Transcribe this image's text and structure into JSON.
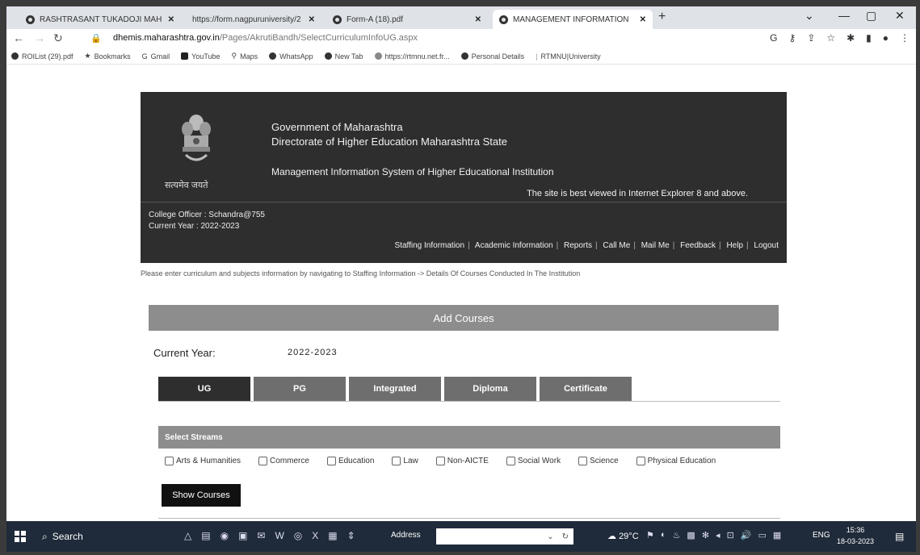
{
  "browser": {
    "tabs": [
      {
        "title": "RASHTRASANT TUKADOJI MAH",
        "active": false
      },
      {
        "title": "https://form.nagpuruniversity/2",
        "active": false
      },
      {
        "title": "Form-A (18).pdf",
        "active": false
      },
      {
        "title": "MANAGEMENT INFORMATION",
        "active": true
      }
    ],
    "new_tab": "+",
    "url_domain": "dhemis.maharashtra.gov.in",
    "url_path": "/Pages/AkrutiBandh/SelectCurriculumInfoUG.aspx",
    "bookmarks": [
      {
        "label": "ROIList (29).pdf",
        "color": "#333333"
      },
      {
        "label": "Bookmarks",
        "color": "#333333"
      },
      {
        "label": "Gmail",
        "color": "#777777"
      },
      {
        "label": "YouTube",
        "color": "#222222"
      },
      {
        "label": "Maps",
        "color": "#444444"
      },
      {
        "label": "WhatsApp",
        "color": "#333333"
      },
      {
        "label": "New Tab",
        "color": "#333333"
      },
      {
        "label": "https://rtmnu.net.fr...",
        "color": "#888888"
      },
      {
        "label": "Personal Details",
        "color": "#333333"
      },
      {
        "label": "RTMNU|University",
        "color": "#888888"
      }
    ]
  },
  "header": {
    "motto": "सत्यमेव जयते",
    "gov_line1": "Government of Maharashtra",
    "gov_line2": "Directorate of Higher Education Maharashtra State",
    "system_title": "Management Information System of Higher Educational Institution",
    "best_viewed": "The site is best viewed in Internet Explorer 8 and above.",
    "college_officer": "College Officer : Schandra@755",
    "current_year": "Current Year : 2022-2023"
  },
  "menu": [
    "Staffing Information",
    "Academic Information",
    "Reports",
    "Call Me",
    "Mail Me",
    "Feedback",
    "Help",
    "Logout"
  ],
  "notice": "Please enter curriculum and subjects information by navigating to Staffing Information -> Details Of Courses Conducted In The Institution",
  "add_courses": {
    "title": "Add Courses",
    "current_year_label": "Current Year:",
    "current_year_value": "2022-2023",
    "tabs": [
      "UG",
      "PG",
      "Integrated",
      "Diploma",
      "Certificate"
    ],
    "select_streams_label": "Select Streams",
    "streams": [
      "Arts & Humanities",
      "Commerce",
      "Education",
      "Law",
      "Non-AICTE",
      "Social Work",
      "Science",
      "Physical Education"
    ],
    "show_courses_label": "Show Courses"
  },
  "taskbar": {
    "search_label": "Search",
    "address_label": "Address",
    "temperature": "29°C",
    "language": "ENG",
    "time": "15:36",
    "date": "18-03-2023"
  }
}
